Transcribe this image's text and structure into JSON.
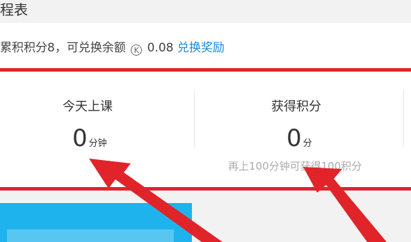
{
  "header": {
    "title": "程表"
  },
  "points": {
    "prefix": "累积积分8，可兑换余额",
    "coin_glyph": "K",
    "balance": "0.08",
    "redeem_label": "兑换奖励"
  },
  "stats": {
    "today": {
      "label": "今天上课",
      "value": "0",
      "unit": "分钟"
    },
    "earned": {
      "label": "获得积分",
      "value": "0",
      "unit": "分",
      "hint": "再上100分钟可获得100积分"
    }
  },
  "colors": {
    "accent": "#e0242a",
    "link": "#1a8be0",
    "card": "#1fb3ee"
  }
}
